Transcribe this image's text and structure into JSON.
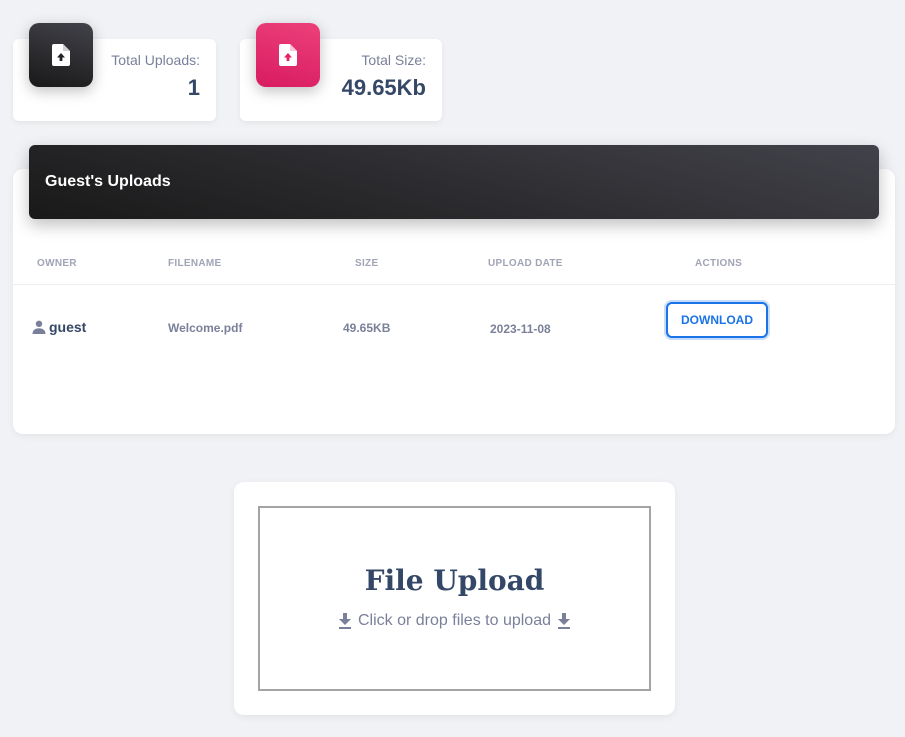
{
  "stats": {
    "uploads": {
      "label": "Total Uploads:",
      "value": "1",
      "icon": "file-upload-icon",
      "color": "#2d2d2f"
    },
    "size": {
      "label": "Total Size:",
      "value": "49.65Kb",
      "icon": "file-upload-icon",
      "color": "#e91e63"
    }
  },
  "uploads": {
    "title": "Guest's Uploads",
    "columns": [
      "OWNER",
      "FILENAME",
      "SIZE",
      "UPLOAD DATE",
      "ACTIONS"
    ],
    "rows": [
      {
        "owner": "guest",
        "owner_icon": "person-icon",
        "filename": "Welcome.pdf",
        "size": "49.65KB",
        "date": "2023-11-08",
        "action": "DOWNLOAD"
      }
    ]
  },
  "upload_box": {
    "title": "File Upload",
    "subtitle": "Click or drop files to upload",
    "icon": "download-arrow-icon"
  },
  "colors": {
    "accent": "#1a73e8",
    "pink": "#e91e63",
    "dark": "#344767",
    "muted": "#7b809a",
    "background": "#f0f2f5"
  }
}
